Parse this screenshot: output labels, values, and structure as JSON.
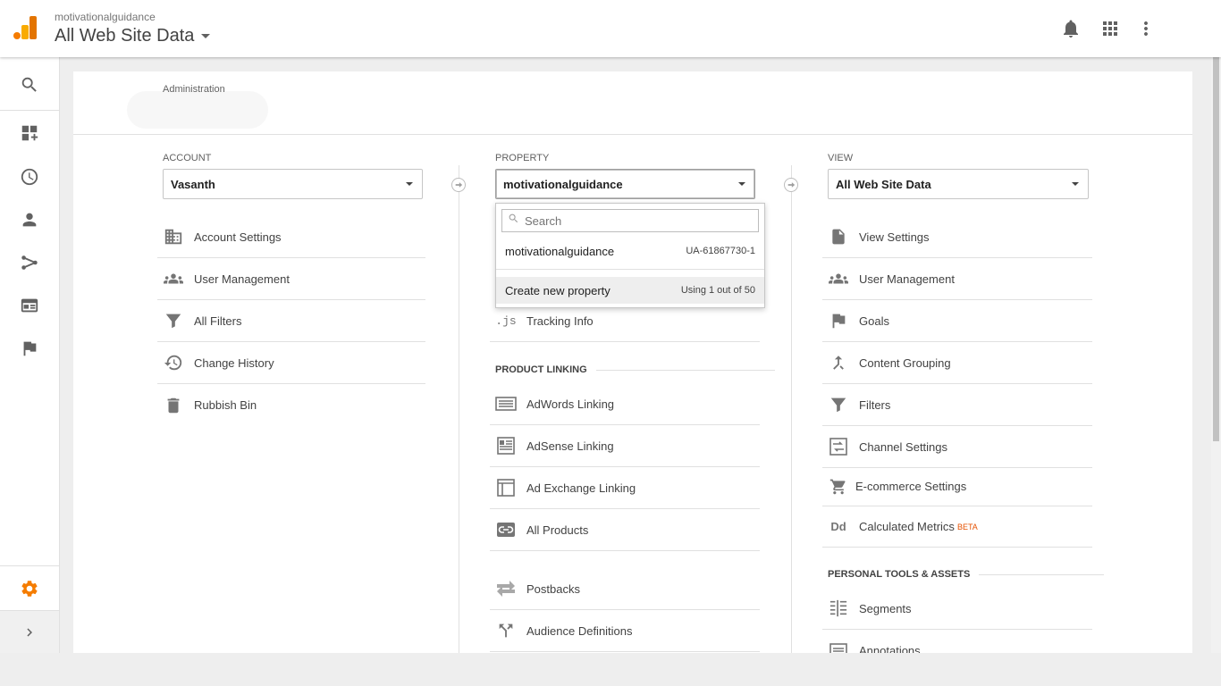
{
  "header": {
    "account_name": "motivationalguidance",
    "view_selector": "All Web Site Data",
    "icons": [
      "notifications-icon",
      "apps-grid-icon",
      "more-vert-icon"
    ]
  },
  "leftnav": {
    "items": [
      "search-icon",
      "dashboard-add-icon",
      "clock-icon",
      "person-icon",
      "acquisition-icon",
      "browser-window-icon",
      "flag-icon"
    ],
    "bottom": [
      "admin-gear-icon",
      "chevron-right-icon"
    ],
    "active_color": "#f57c00"
  },
  "admin": {
    "title": "Administration"
  },
  "account": {
    "label": "ACCOUNT",
    "selected": "Vasanth",
    "items": [
      {
        "label": "Account Settings",
        "icon": "building-icon"
      },
      {
        "label": "User Management",
        "icon": "people-icon"
      },
      {
        "label": "All Filters",
        "icon": "filter-icon"
      },
      {
        "label": "Change History",
        "icon": "history-icon"
      },
      {
        "label": "Rubbish Bin",
        "icon": "trash-icon"
      }
    ]
  },
  "property": {
    "label": "PROPERTY",
    "selected": "motivationalguidance",
    "tracking_info": {
      "label": "Tracking Info",
      "icon_text": ".js"
    },
    "product_linking_heading": "PRODUCT LINKING",
    "items": [
      {
        "label": "AdWords Linking",
        "icon": "adwords-icon"
      },
      {
        "label": "AdSense Linking",
        "icon": "adsense-icon"
      },
      {
        "label": "Ad Exchange Linking",
        "icon": "adexchange-icon"
      },
      {
        "label": "All Products",
        "icon": "link-icon"
      },
      {
        "label": "Postbacks",
        "icon": "postbacks-icon"
      },
      {
        "label": "Audience Definitions",
        "icon": "audience-fork-icon"
      }
    ],
    "dropdown": {
      "search_placeholder": "Search",
      "result_name": "motivationalguidance",
      "result_id": "UA-61867730-1",
      "create_label": "Create new property",
      "usage": "Using 1 out of 50"
    }
  },
  "view": {
    "label": "VIEW",
    "selected": "All Web Site Data",
    "items": [
      {
        "label": "View Settings",
        "icon": "document-icon"
      },
      {
        "label": "User Management",
        "icon": "people-icon"
      },
      {
        "label": "Goals",
        "icon": "flag-icon"
      },
      {
        "label": "Content Grouping",
        "icon": "merge-icon"
      },
      {
        "label": "Filters",
        "icon": "filter-icon"
      },
      {
        "label": "Channel Settings",
        "icon": "channel-icon"
      },
      {
        "label": "E-commerce Settings",
        "icon": "cart-icon"
      },
      {
        "label": "Calculated Metrics",
        "icon": "dd-icon",
        "badge": "BETA",
        "icon_text": "Dd"
      }
    ],
    "personal_heading": "PERSONAL TOOLS & ASSETS",
    "personal_items": [
      {
        "label": "Segments",
        "icon": "segments-icon"
      },
      {
        "label": "Annotations",
        "icon": "annotations-icon"
      }
    ]
  }
}
